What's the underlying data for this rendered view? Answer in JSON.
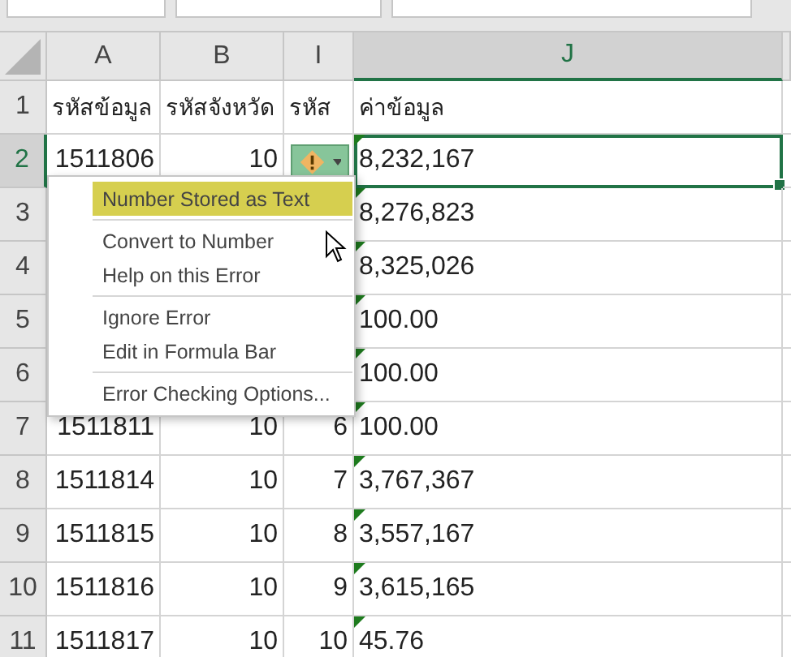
{
  "columns": [
    {
      "label": "A",
      "selected": false
    },
    {
      "label": "B",
      "selected": false
    },
    {
      "label": "I",
      "selected": false
    },
    {
      "label": "J",
      "selected": true
    }
  ],
  "rows": [
    {
      "header": "1",
      "selected": false,
      "a": "รหัสข้อมูล",
      "b": "รหัสจังหวัด",
      "i": "รหัส",
      "j": "ค่าข้อมูล",
      "j_selected": false,
      "error_flag": false,
      "kind": "text"
    },
    {
      "header": "2",
      "selected": true,
      "a": "1511806",
      "b": "10",
      "j": "8,232,167",
      "j_selected": true,
      "error_flag": true,
      "kind": "number",
      "smart_tag": true
    },
    {
      "header": "3",
      "selected": false,
      "j": "8,276,823",
      "j_selected": false,
      "error_flag": true,
      "kind": "number"
    },
    {
      "header": "4",
      "selected": false,
      "j": "8,325,026",
      "j_selected": false,
      "error_flag": true,
      "kind": "number"
    },
    {
      "header": "5",
      "selected": false,
      "j": "100.00",
      "j_selected": false,
      "error_flag": true,
      "kind": "number"
    },
    {
      "header": "6",
      "selected": false,
      "j": "100.00",
      "j_selected": false,
      "error_flag": true,
      "kind": "number"
    },
    {
      "header": "7",
      "selected": false,
      "a": "1511811",
      "b": "10",
      "i": "6",
      "j": "100.00",
      "j_selected": false,
      "error_flag": true,
      "kind": "number"
    },
    {
      "header": "8",
      "selected": false,
      "a": "1511814",
      "b": "10",
      "i": "7",
      "j": "3,767,367",
      "j_selected": false,
      "error_flag": true,
      "kind": "number"
    },
    {
      "header": "9",
      "selected": false,
      "a": "1511815",
      "b": "10",
      "i": "8",
      "j": "3,557,167",
      "j_selected": false,
      "error_flag": true,
      "kind": "number"
    },
    {
      "header": "10",
      "selected": false,
      "a": "1511816",
      "b": "10",
      "i": "9",
      "j": "3,615,165",
      "j_selected": false,
      "error_flag": true,
      "kind": "number"
    },
    {
      "header": "11",
      "selected": false,
      "a": "1511817",
      "b": "10",
      "i": "10",
      "j": "45.76",
      "j_selected": false,
      "error_flag": true,
      "kind": "number"
    }
  ],
  "menu": {
    "items": [
      {
        "label": "Number Stored as Text",
        "kind": "title",
        "selected": true
      },
      {
        "kind": "separator"
      },
      {
        "label": "Convert to Number",
        "kind": "item",
        "selected": false
      },
      {
        "label": "Help on this Error",
        "kind": "item",
        "selected": false
      },
      {
        "kind": "separator"
      },
      {
        "label": "Ignore Error",
        "kind": "item",
        "selected": false
      },
      {
        "label": "Edit in Formula Bar",
        "kind": "item",
        "selected": false
      },
      {
        "kind": "separator"
      },
      {
        "label": "Error Checking Options...",
        "kind": "item",
        "selected": false
      }
    ]
  }
}
